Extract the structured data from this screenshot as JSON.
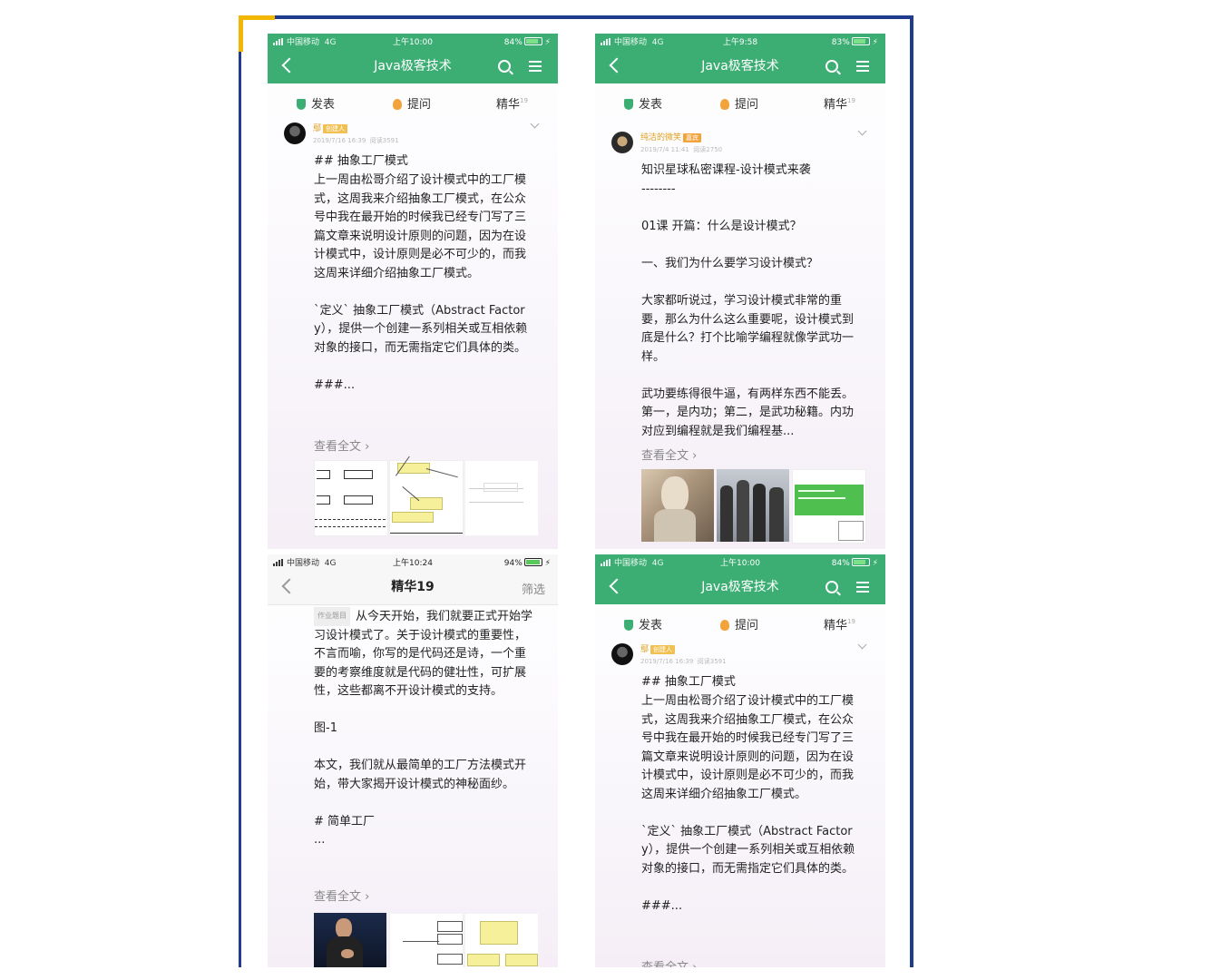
{
  "screens": [
    {
      "status": {
        "carrier": "中国移动",
        "network": "4G",
        "time": "上午10:00",
        "battery": "84%",
        "battery_level": 0.84
      },
      "header": {
        "title": "Java极客技术",
        "back_icon": "chevron-left-icon",
        "search_icon": "search-icon",
        "menu_icon": "menu-icon"
      },
      "tabs": [
        {
          "label": "发表",
          "icon": "shield-icon"
        },
        {
          "label": "提问",
          "icon": "bulb-icon"
        },
        {
          "label": "精华",
          "count": "19"
        }
      ],
      "post": {
        "author": "鄢",
        "badge": "创建人",
        "time": "2019/7/16 16:39",
        "reads": "阅读3591",
        "heading": "## 抽象工厂模式",
        "body": "上一周由松哥介绍了设计模式中的工厂模式，这周我来介绍抽象工厂模式，在公众号中我在最开始的时候我已经专门写了三篇文章来说明设计原则的问题，因为在设计模式中，设计原则是必不可少的，而我这周来详细介绍抽象工厂模式。\n\n`定义` 抽象工厂模式（Abstract Factory），提供一个创建一系列相关或互相依赖对象的接口，而无需指定它们具体的类。\n\n###...",
        "more": "查看全文 ›"
      }
    },
    {
      "status": {
        "carrier": "中国移动",
        "network": "4G",
        "time": "上午9:58",
        "battery": "83%",
        "battery_level": 0.83
      },
      "header": {
        "title": "Java极客技术"
      },
      "tabs": [
        {
          "label": "发表"
        },
        {
          "label": "提问"
        },
        {
          "label": "精华",
          "count": "19"
        }
      ],
      "post": {
        "author": "纯洁的微笑",
        "badge": "嘉宾",
        "time": "2019/7/4 11:41",
        "reads": "阅读2750",
        "heading": "知识星球私密课程-设计模式来袭",
        "body": "--------\n\n01课 开篇：什么是设计模式？\n\n一、我们为什么要学习设计模式？\n\n大家都听说过，学习设计模式非常的重要，那么为什么这么重要呢，设计模式到底是什么？打个比喻学编程就像学武功一样。\n\n武功要练得很牛逼，有两样东西不能丢。第一，是内功；第二，是武功秘籍。内功对应到编程就是我们编程基...",
        "more": "查看全文 ›"
      }
    },
    {
      "status": {
        "carrier": "中国移动",
        "network": "4G",
        "time": "上午10:24",
        "battery": "94%",
        "battery_level": 0.94
      },
      "header": {
        "title": "精华19",
        "filter": "筛选"
      },
      "post": {
        "tag": "作业题目",
        "body": "从今天开始，我们就要正式开始学习设计模式了。关于设计模式的重要性，不言而喻，你写的是代码还是诗，一个重要的考察维度就是代码的健壮性，可扩展性，这些都离不开设计模式的支持。\n\n图-1\n\n本文，我们就从最简单的工厂方法模式开始，带大家揭开设计模式的神秘面纱。\n\n# 简单工厂\n...",
        "more": "查看全文 ›"
      }
    },
    {
      "status": {
        "carrier": "中国移动",
        "network": "4G",
        "time": "上午10:00",
        "battery": "84%",
        "battery_level": 0.84
      },
      "header": {
        "title": "Java极客技术"
      },
      "tabs": [
        {
          "label": "发表"
        },
        {
          "label": "提问"
        },
        {
          "label": "精华",
          "count": "19"
        }
      ],
      "post": {
        "author": "鄢",
        "badge": "创建人",
        "time": "2019/7/16 16:39",
        "reads": "阅读3591",
        "heading": "## 抽象工厂模式",
        "body": "上一周由松哥介绍了设计模式中的工厂模式，这周我来介绍抽象工厂模式，在公众号中我在最开始的时候我已经专门写了三篇文章来说明设计原则的问题，因为在设计模式中，设计原则是必不可少的，而我这周来详细介绍抽象工厂模式。\n\n`定义` 抽象工厂模式（Abstract Factory），提供一个创建一系列相关或互相依赖对象的接口，而无需指定它们具体的类。\n\n###...",
        "more": "查看全文 ›"
      }
    }
  ],
  "colors": {
    "header_green": "#3cae74",
    "frame_blue": "#1f3c8f",
    "frame_yellow": "#f2b705"
  }
}
